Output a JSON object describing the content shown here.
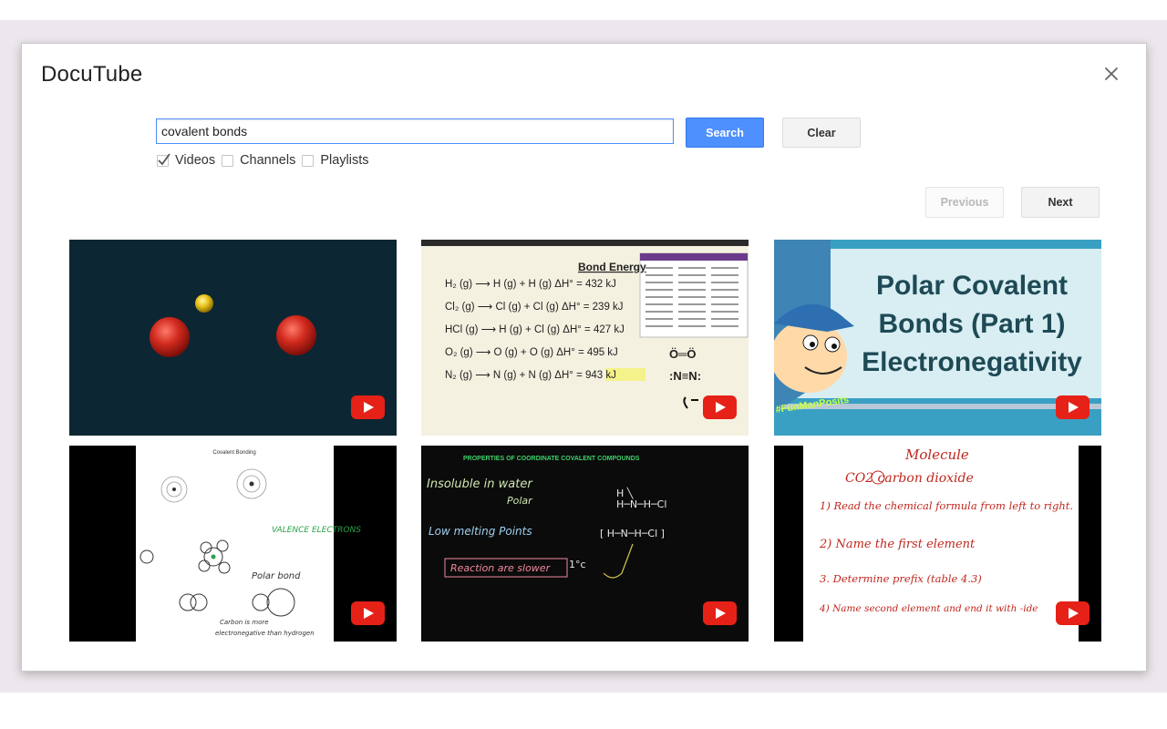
{
  "app": {
    "title": "DocuTube"
  },
  "search": {
    "value": "covalent bonds",
    "button_label": "Search",
    "clear_label": "Clear"
  },
  "filters": [
    {
      "label": "Videos",
      "checked": true
    },
    {
      "label": "Channels",
      "checked": false
    },
    {
      "label": "Playlists",
      "checked": false
    }
  ],
  "pagination": {
    "previous_label": "Previous",
    "next_label": "Next",
    "previous_enabled": false
  },
  "results": [
    {
      "thumb": "molecule-3d"
    },
    {
      "thumb": "bond-energy",
      "heading": "Bond Energy",
      "rows": [
        "H₂ (g) ⟶ H (g) + H (g)  ΔH° = 432 kJ",
        "Cl₂ (g) ⟶ Cl (g) + Cl (g)  ΔH° = 239 kJ",
        "HCl (g) ⟶ H (g) + Cl (g)  ΔH° = 427 kJ",
        "O₂ (g) ⟶ O (g) + O (g)  ΔH° = 495 kJ",
        "N₂ (g) ⟶ N (g) + N (g)  ΔH° = 943 kJ"
      ]
    },
    {
      "thumb": "polar-covalent",
      "lines": [
        "Polar Covalent",
        "Bonds (Part 1)",
        "Electronegativity"
      ],
      "tag": "#FunManPosits"
    },
    {
      "thumb": "covalent-bonding-notes",
      "heading": "Covalent Bonding",
      "notes": [
        "VALENCE ELECTRONS",
        "Polar bond"
      ]
    },
    {
      "thumb": "coordinate-compounds",
      "heading": "PROPERTIES OF COORDINATE COVALENT COMPOUNDS",
      "notes": [
        "Insoluble in water",
        "Polar",
        "Low melting Points",
        "Reaction are slower"
      ]
    },
    {
      "thumb": "carbon-dioxide",
      "notes": [
        "Molecule",
        "CO2  carbon dioxide",
        "1) Read the chemical formula from left to right.",
        "2) Name the first element",
        "3. Determine prefix (table 4.3)",
        "4) Name second element and end it with -ide"
      ]
    }
  ],
  "colors": {
    "accent": "#4d90fe",
    "play": "#e62117"
  }
}
